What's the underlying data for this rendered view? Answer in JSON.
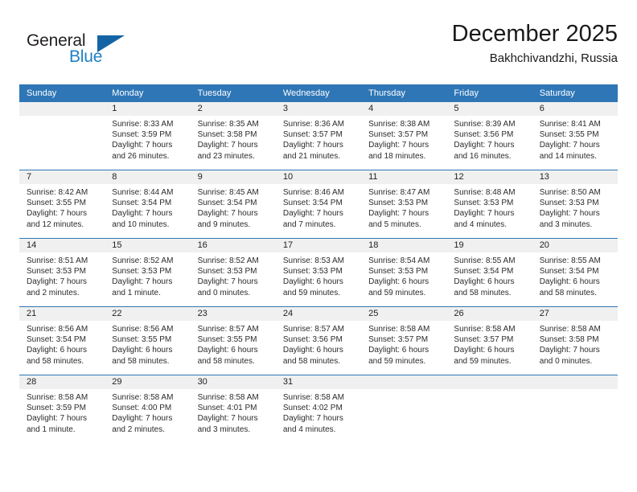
{
  "brand": {
    "name_part1": "General",
    "name_part2": "Blue",
    "accent_color": "#1464a5",
    "text_color": "#231f20"
  },
  "header": {
    "title": "December 2025",
    "subtitle": "Bakhchivandzhi, Russia"
  },
  "theme": {
    "header_bar_color": "#2f76b6",
    "daynum_band_color": "#f0f0f0",
    "grid_line_color": "#2f76b6",
    "page_background": "#ffffff"
  },
  "weekday_headers": [
    "Sunday",
    "Monday",
    "Tuesday",
    "Wednesday",
    "Thursday",
    "Friday",
    "Saturday"
  ],
  "weeks": [
    [
      {
        "day": "",
        "lines": []
      },
      {
        "day": "1",
        "lines": [
          "Sunrise: 8:33 AM",
          "Sunset: 3:59 PM",
          "Daylight: 7 hours",
          "and 26 minutes."
        ]
      },
      {
        "day": "2",
        "lines": [
          "Sunrise: 8:35 AM",
          "Sunset: 3:58 PM",
          "Daylight: 7 hours",
          "and 23 minutes."
        ]
      },
      {
        "day": "3",
        "lines": [
          "Sunrise: 8:36 AM",
          "Sunset: 3:57 PM",
          "Daylight: 7 hours",
          "and 21 minutes."
        ]
      },
      {
        "day": "4",
        "lines": [
          "Sunrise: 8:38 AM",
          "Sunset: 3:57 PM",
          "Daylight: 7 hours",
          "and 18 minutes."
        ]
      },
      {
        "day": "5",
        "lines": [
          "Sunrise: 8:39 AM",
          "Sunset: 3:56 PM",
          "Daylight: 7 hours",
          "and 16 minutes."
        ]
      },
      {
        "day": "6",
        "lines": [
          "Sunrise: 8:41 AM",
          "Sunset: 3:55 PM",
          "Daylight: 7 hours",
          "and 14 minutes."
        ]
      }
    ],
    [
      {
        "day": "7",
        "lines": [
          "Sunrise: 8:42 AM",
          "Sunset: 3:55 PM",
          "Daylight: 7 hours",
          "and 12 minutes."
        ]
      },
      {
        "day": "8",
        "lines": [
          "Sunrise: 8:44 AM",
          "Sunset: 3:54 PM",
          "Daylight: 7 hours",
          "and 10 minutes."
        ]
      },
      {
        "day": "9",
        "lines": [
          "Sunrise: 8:45 AM",
          "Sunset: 3:54 PM",
          "Daylight: 7 hours",
          "and 9 minutes."
        ]
      },
      {
        "day": "10",
        "lines": [
          "Sunrise: 8:46 AM",
          "Sunset: 3:54 PM",
          "Daylight: 7 hours",
          "and 7 minutes."
        ]
      },
      {
        "day": "11",
        "lines": [
          "Sunrise: 8:47 AM",
          "Sunset: 3:53 PM",
          "Daylight: 7 hours",
          "and 5 minutes."
        ]
      },
      {
        "day": "12",
        "lines": [
          "Sunrise: 8:48 AM",
          "Sunset: 3:53 PM",
          "Daylight: 7 hours",
          "and 4 minutes."
        ]
      },
      {
        "day": "13",
        "lines": [
          "Sunrise: 8:50 AM",
          "Sunset: 3:53 PM",
          "Daylight: 7 hours",
          "and 3 minutes."
        ]
      }
    ],
    [
      {
        "day": "14",
        "lines": [
          "Sunrise: 8:51 AM",
          "Sunset: 3:53 PM",
          "Daylight: 7 hours",
          "and 2 minutes."
        ]
      },
      {
        "day": "15",
        "lines": [
          "Sunrise: 8:52 AM",
          "Sunset: 3:53 PM",
          "Daylight: 7 hours",
          "and 1 minute."
        ]
      },
      {
        "day": "16",
        "lines": [
          "Sunrise: 8:52 AM",
          "Sunset: 3:53 PM",
          "Daylight: 7 hours",
          "and 0 minutes."
        ]
      },
      {
        "day": "17",
        "lines": [
          "Sunrise: 8:53 AM",
          "Sunset: 3:53 PM",
          "Daylight: 6 hours",
          "and 59 minutes."
        ]
      },
      {
        "day": "18",
        "lines": [
          "Sunrise: 8:54 AM",
          "Sunset: 3:53 PM",
          "Daylight: 6 hours",
          "and 59 minutes."
        ]
      },
      {
        "day": "19",
        "lines": [
          "Sunrise: 8:55 AM",
          "Sunset: 3:54 PM",
          "Daylight: 6 hours",
          "and 58 minutes."
        ]
      },
      {
        "day": "20",
        "lines": [
          "Sunrise: 8:55 AM",
          "Sunset: 3:54 PM",
          "Daylight: 6 hours",
          "and 58 minutes."
        ]
      }
    ],
    [
      {
        "day": "21",
        "lines": [
          "Sunrise: 8:56 AM",
          "Sunset: 3:54 PM",
          "Daylight: 6 hours",
          "and 58 minutes."
        ]
      },
      {
        "day": "22",
        "lines": [
          "Sunrise: 8:56 AM",
          "Sunset: 3:55 PM",
          "Daylight: 6 hours",
          "and 58 minutes."
        ]
      },
      {
        "day": "23",
        "lines": [
          "Sunrise: 8:57 AM",
          "Sunset: 3:55 PM",
          "Daylight: 6 hours",
          "and 58 minutes."
        ]
      },
      {
        "day": "24",
        "lines": [
          "Sunrise: 8:57 AM",
          "Sunset: 3:56 PM",
          "Daylight: 6 hours",
          "and 58 minutes."
        ]
      },
      {
        "day": "25",
        "lines": [
          "Sunrise: 8:58 AM",
          "Sunset: 3:57 PM",
          "Daylight: 6 hours",
          "and 59 minutes."
        ]
      },
      {
        "day": "26",
        "lines": [
          "Sunrise: 8:58 AM",
          "Sunset: 3:57 PM",
          "Daylight: 6 hours",
          "and 59 minutes."
        ]
      },
      {
        "day": "27",
        "lines": [
          "Sunrise: 8:58 AM",
          "Sunset: 3:58 PM",
          "Daylight: 7 hours",
          "and 0 minutes."
        ]
      }
    ],
    [
      {
        "day": "28",
        "lines": [
          "Sunrise: 8:58 AM",
          "Sunset: 3:59 PM",
          "Daylight: 7 hours",
          "and 1 minute."
        ]
      },
      {
        "day": "29",
        "lines": [
          "Sunrise: 8:58 AM",
          "Sunset: 4:00 PM",
          "Daylight: 7 hours",
          "and 2 minutes."
        ]
      },
      {
        "day": "30",
        "lines": [
          "Sunrise: 8:58 AM",
          "Sunset: 4:01 PM",
          "Daylight: 7 hours",
          "and 3 minutes."
        ]
      },
      {
        "day": "31",
        "lines": [
          "Sunrise: 8:58 AM",
          "Sunset: 4:02 PM",
          "Daylight: 7 hours",
          "and 4 minutes."
        ]
      },
      {
        "day": "",
        "lines": []
      },
      {
        "day": "",
        "lines": []
      },
      {
        "day": "",
        "lines": []
      }
    ]
  ]
}
